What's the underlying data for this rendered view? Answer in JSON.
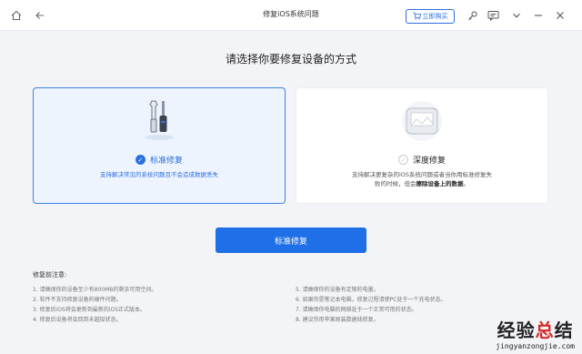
{
  "window": {
    "title": "修复iOS系统问题",
    "buy_button": "立即购买",
    "icons": [
      "home-icon",
      "back-icon",
      "cart-icon",
      "key-icon",
      "feedback-icon",
      "chevron-down-icon",
      "minimize-icon",
      "close-icon"
    ]
  },
  "main": {
    "heading": "请选择你要修复设备的方式"
  },
  "cards": [
    {
      "title": "标准修复",
      "selected": true,
      "description": "支持解决常见的系统问题且不会造成数据丢失"
    },
    {
      "title": "深度修复",
      "selected": false,
      "description_lines": [
        "支持解决更复杂的iOS系统问题或者当你用标准修复失",
        "败的时候，但会"
      ],
      "description_bold": "擦除设备上的数据",
      "description_end": "。"
    }
  ],
  "action_button": "标准修复",
  "notes": {
    "title": "修复前注意:",
    "left": [
      "1.  请确保你的设备至少有800MB的剩余可用空间。",
      "2.  软件不支持修复设备的硬件问题。",
      "3.  修复后iOS将会更新到最新的iOS正式版本。",
      "4.  修复后设备将会回到未越狱状态。"
    ],
    "right": [
      "5.  请确保你的设备有足够的电量。",
      "6.  如果你是笔记本电脑，修复过程请使PC处于一个充电状态。",
      "7.  请确保你电脑的网络处于一个正常可用的状态。",
      "8.  建议你用苹果原装数据线修复。"
    ]
  },
  "watermark": {
    "text_black": "经验",
    "text_red": "总",
    "text_black2": "结",
    "url": "jingyanzongjie.com"
  },
  "colors": {
    "accent": "#2b6fe0",
    "button": "#1e6fe8",
    "watermark_red": "#d42b2b"
  }
}
